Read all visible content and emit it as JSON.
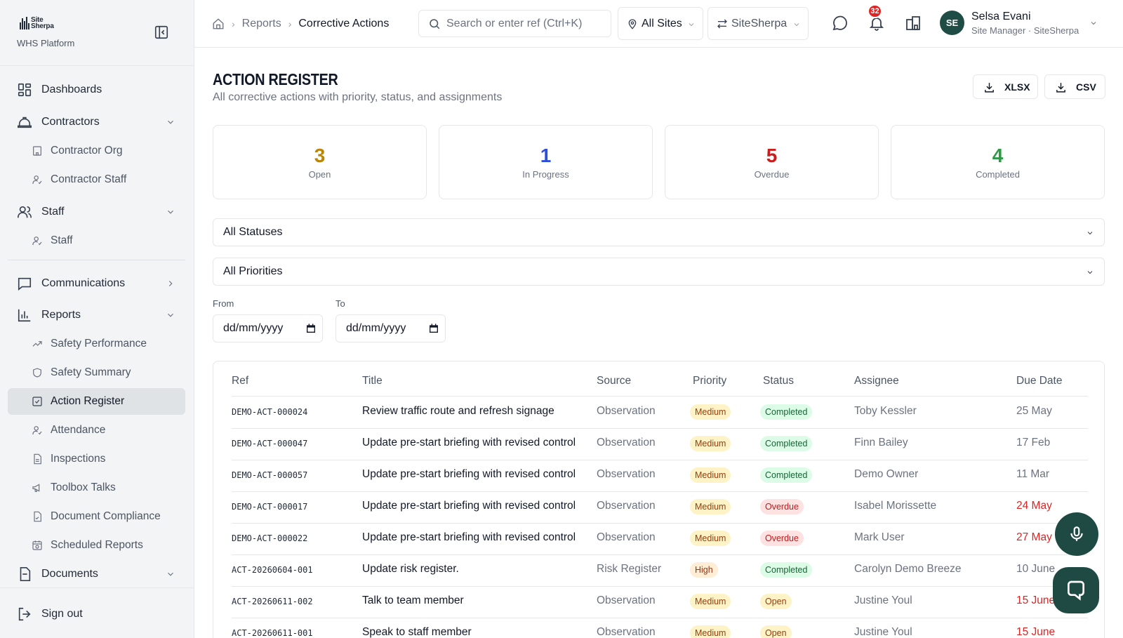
{
  "brand": {
    "logo_line1": "Site",
    "logo_line2": "Sherpa",
    "subtitle": "WHS Platform"
  },
  "nav": {
    "dashboards": "Dashboards",
    "contractors": "Contractors",
    "contractor_org": "Contractor Org",
    "contractor_staff": "Contractor Staff",
    "staff": "Staff",
    "staff_sub": "Staff",
    "communications": "Communications",
    "reports": "Reports",
    "safety_performance": "Safety Performance",
    "safety_summary": "Safety Summary",
    "action_register": "Action Register",
    "attendance": "Attendance",
    "inspections": "Inspections",
    "toolbox_talks": "Toolbox Talks",
    "document_compliance": "Document Compliance",
    "scheduled_reports": "Scheduled Reports",
    "documents": "Documents",
    "sign_out": "Sign out"
  },
  "topbar": {
    "breadcrumb_parent": "Reports",
    "breadcrumb_current": "Corrective Actions",
    "search_placeholder": "Search or enter ref (Ctrl+K)",
    "site_filter": "All Sites",
    "org_switcher": "SiteSherpa",
    "notification_count": "32",
    "user_initials": "SE",
    "user_name": "Selsa Evani",
    "user_role": "Site Manager · SiteSherpa"
  },
  "page": {
    "title": "ACTION REGISTER",
    "subtitle": "All corrective actions with priority, status, and assignments",
    "export_xlsx": "XLSX",
    "export_csv": "CSV"
  },
  "stats": [
    {
      "value": "3",
      "label": "Open",
      "color": "#b7860b"
    },
    {
      "value": "1",
      "label": "In Progress",
      "color": "#2b4fd8"
    },
    {
      "value": "5",
      "label": "Overdue",
      "color": "#c81e1e"
    },
    {
      "value": "4",
      "label": "Completed",
      "color": "#2e9a48"
    }
  ],
  "filters": {
    "status": "All Statuses",
    "priority": "All Priorities",
    "from_label": "From",
    "to_label": "To",
    "date_placeholder": "dd/mm/yyyy"
  },
  "table": {
    "columns": [
      "Ref",
      "Title",
      "Source",
      "Priority",
      "Status",
      "Assignee",
      "Due Date"
    ],
    "rows": [
      {
        "ref": "DEMO-ACT-000024",
        "title": "Review traffic route and refresh signage",
        "source": "Observation",
        "priority": "Medium",
        "status": "Completed",
        "assignee": "Toby Kessler",
        "due": "25 May",
        "due_overdue": false
      },
      {
        "ref": "DEMO-ACT-000047",
        "title": "Update pre-start briefing with revised control",
        "source": "Observation",
        "priority": "Medium",
        "status": "Completed",
        "assignee": "Finn Bailey",
        "due": "17 Feb",
        "due_overdue": false
      },
      {
        "ref": "DEMO-ACT-000057",
        "title": "Update pre-start briefing with revised control",
        "source": "Observation",
        "priority": "Medium",
        "status": "Completed",
        "assignee": "Demo Owner",
        "due": "11 Mar",
        "due_overdue": false
      },
      {
        "ref": "DEMO-ACT-000017",
        "title": "Update pre-start briefing with revised control",
        "source": "Observation",
        "priority": "Medium",
        "status": "Overdue",
        "assignee": "Isabel Morissette",
        "due": "24 May",
        "due_overdue": true
      },
      {
        "ref": "DEMO-ACT-000022",
        "title": "Update pre-start briefing with revised control",
        "source": "Observation",
        "priority": "Medium",
        "status": "Overdue",
        "assignee": "Mark User",
        "due": "27 May",
        "due_overdue": true
      },
      {
        "ref": "ACT-20260604-001",
        "title": "Update risk register.",
        "source": "Risk Register",
        "priority": "High",
        "status": "Completed",
        "assignee": "Carolyn Demo Breeze",
        "due": "10 June",
        "due_overdue": false
      },
      {
        "ref": "ACT-20260611-002",
        "title": "Talk to team member",
        "source": "Observation",
        "priority": "Medium",
        "status": "Open",
        "assignee": "Justine Youl",
        "due": "15 June",
        "due_overdue": true
      },
      {
        "ref": "ACT-20260611-001",
        "title": "Speak to staff member",
        "source": "Observation",
        "priority": "Medium",
        "status": "Open",
        "assignee": "Justine Youl",
        "due": "15 June",
        "due_overdue": true
      }
    ]
  }
}
